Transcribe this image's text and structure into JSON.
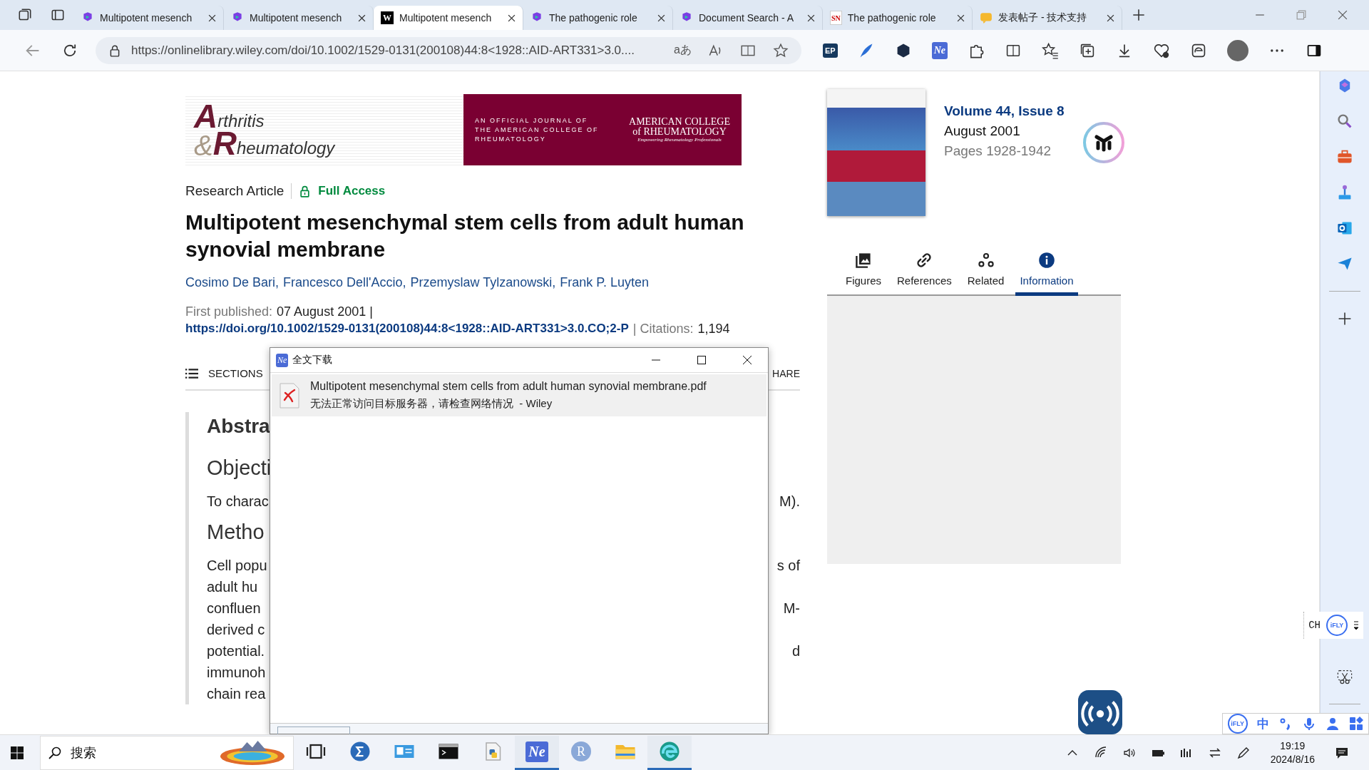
{
  "browser": {
    "tabs": [
      {
        "title": "Multipotent mesench",
        "kind": "logo",
        "selected": false
      },
      {
        "title": "Multipotent mesench",
        "kind": "logo",
        "selected": false
      },
      {
        "title": "Multipotent mesench",
        "kind": "letter",
        "glyph": "W",
        "selected": true
      },
      {
        "title": "The pathogenic role",
        "kind": "logo",
        "selected": false
      },
      {
        "title": "Document Search - A",
        "kind": "logo",
        "selected": false
      },
      {
        "title": "The pathogenic role",
        "kind": "letter",
        "glyph": "SN",
        "selected": false
      },
      {
        "title": "发表帖子 - 技术支持",
        "kind": "note",
        "selected": false
      }
    ],
    "url": "https://onlinelibrary.wiley.com/doi/10.1002/1529-0131(200108)44:8<1928::AID-ART331>3.0....",
    "translate_glyph": "aあ",
    "extension_badges": [
      "EP",
      "Ne"
    ]
  },
  "journal": {
    "logo": {
      "initial_1": "A",
      "rest_1": "rthritis",
      "ampersand": "&",
      "initial_2": "R",
      "rest_2": "heumatology"
    },
    "banner": {
      "tagline": [
        "AN OFFICIAL JOURNAL OF",
        "THE AMERICAN COLLEGE OF",
        "RHEUMATOLOGY"
      ],
      "society": [
        "AMERICAN COLLEGE",
        "of RHEUMATOLOGY"
      ],
      "motto": "Empowering Rheumatology Professionals"
    }
  },
  "article": {
    "type": "Research Article",
    "access": "Full Access",
    "title": "Multipotent mesenchymal stem cells from adult human synovial membrane",
    "authors": [
      "Cosimo De Bari,",
      "Francesco Dell'Accio,",
      "Przemyslaw Tylzanowski,",
      "Frank P. Luyten"
    ],
    "published_label": "First published:",
    "published_date": "07 August 2001 |",
    "doi": "https://doi.org/10.1002/1529-0131(200108)44:8<1928::AID-ART331>3.0.CO;2-P",
    "citations_label": "| Citations:",
    "citations": "1,194"
  },
  "sections_bar": {
    "label": "SECTIONS",
    "share": "HARE"
  },
  "abstract": {
    "heading": "Abstra",
    "lines": [
      {
        "kind": "subheading",
        "left": "Objecti"
      },
      {
        "kind": "text",
        "left": "To charac",
        "right": "M)."
      },
      {
        "kind": "subheading",
        "left": "Metho"
      },
      {
        "kind": "text",
        "left": "Cell popu",
        "right": "s of"
      },
      {
        "kind": "text",
        "left": "adult hu"
      },
      {
        "kind": "text",
        "left": "confluen",
        "right": "M-"
      },
      {
        "kind": "text",
        "left": "derived c"
      },
      {
        "kind": "text",
        "left": "potential.",
        "right": "d"
      },
      {
        "kind": "text",
        "left": "immunoh"
      },
      {
        "kind": "text",
        "left": "chain rea"
      }
    ]
  },
  "issue": {
    "volume": "Volume 44, Issue 8",
    "date": "August 2001",
    "pages": "Pages 1928-1942"
  },
  "side_tabs": [
    {
      "label": "Figures",
      "kind": "images",
      "selected": false
    },
    {
      "label": "References",
      "kind": "link",
      "selected": false
    },
    {
      "label": "Related",
      "kind": "related",
      "selected": false
    },
    {
      "label": "Information",
      "kind": "info",
      "selected": true
    }
  ],
  "dialog": {
    "badge": "Ne",
    "title": "全文下载",
    "files": [
      {
        "name": "Multipotent mesenchymal stem cells from adult human synovial membrane.pdf",
        "status": "无法正常访问目标服务器，请检查网络情况",
        "source": "- Wiley",
        "failed": true
      }
    ]
  },
  "ime": {
    "lang": "CH",
    "badge": "iFLY",
    "toolbar_badge": "iFLY",
    "toolbar_lang": "中"
  },
  "taskbar": {
    "search": "搜索",
    "apps": [
      {
        "kind": "taskview",
        "running": false
      },
      {
        "kind": "sigma",
        "running": false
      },
      {
        "kind": "card",
        "running": false
      },
      {
        "kind": "terminal",
        "running": false
      },
      {
        "kind": "python",
        "running": false
      },
      {
        "kind": "ne",
        "glyph": "Ne",
        "running": true
      },
      {
        "kind": "r",
        "glyph": "R",
        "running": false
      },
      {
        "kind": "folder",
        "running": false
      },
      {
        "kind": "edge",
        "running": true
      }
    ],
    "time": "19:19",
    "date": "2024/8/16"
  }
}
